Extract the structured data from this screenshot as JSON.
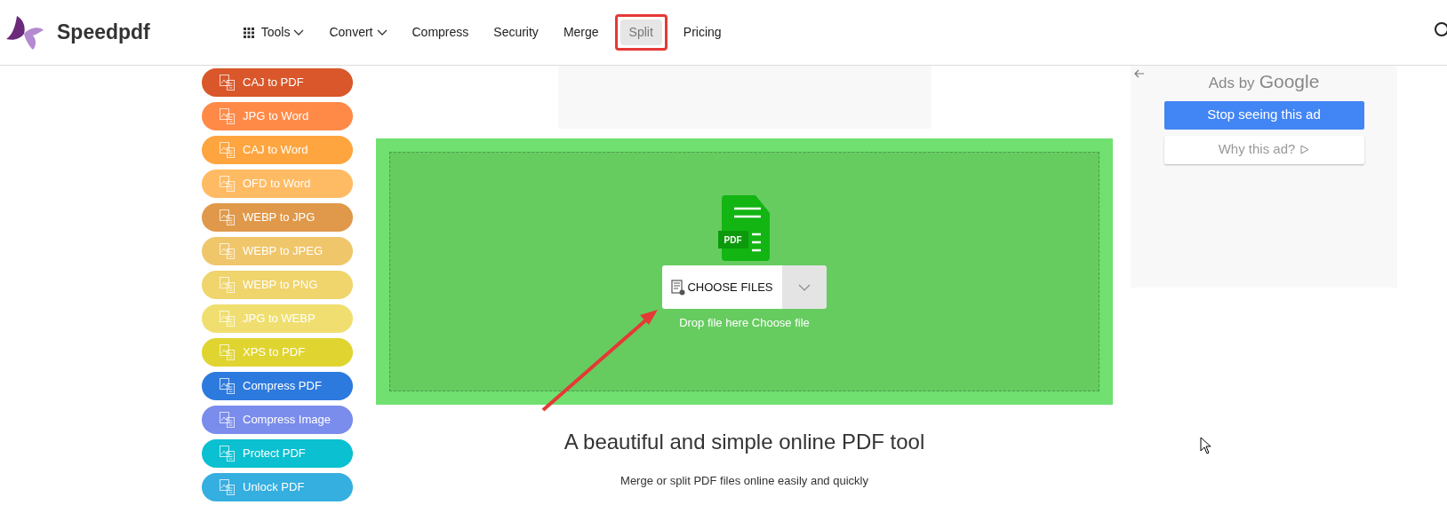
{
  "header": {
    "brand": "Speedpdf",
    "nav": [
      {
        "label": "Tools",
        "kind": "grid-menu",
        "selected": false
      },
      {
        "label": "Convert",
        "kind": "menu",
        "selected": false
      },
      {
        "label": "Compress",
        "kind": "link",
        "selected": false
      },
      {
        "label": "Security",
        "kind": "link",
        "selected": false
      },
      {
        "label": "Merge",
        "kind": "link",
        "selected": false
      },
      {
        "label": "Split",
        "kind": "link",
        "selected": true
      },
      {
        "label": "Pricing",
        "kind": "link",
        "selected": false
      }
    ]
  },
  "sidebar": {
    "items": [
      {
        "label": "CAJ to PDF",
        "color": "#d9572a"
      },
      {
        "label": "JPG to Word",
        "color": "#ff8a47"
      },
      {
        "label": "CAJ to Word",
        "color": "#ffa53f"
      },
      {
        "label": "OFD to Word",
        "color": "#ffbb63"
      },
      {
        "label": "WEBP to JPG",
        "color": "#e0994a"
      },
      {
        "label": "WEBP to JPEG",
        "color": "#f0c66b"
      },
      {
        "label": "WEBP to PNG",
        "color": "#f0d46c"
      },
      {
        "label": "JPG to WEBP",
        "color": "#f0df70"
      },
      {
        "label": "XPS to PDF",
        "color": "#e0d430"
      },
      {
        "label": "Compress PDF",
        "color": "#2d7ade"
      },
      {
        "label": "Compress Image",
        "color": "#7a8cec"
      },
      {
        "label": "Protect PDF",
        "color": "#0bc0d0"
      },
      {
        "label": "Unlock PDF",
        "color": "#35aee0"
      }
    ]
  },
  "upload": {
    "icon_label": "PDF",
    "button": "CHOOSE FILES",
    "hint": "Drop file here Choose file"
  },
  "heading": "A beautiful and simple online PDF tool",
  "subtitle": "Merge or split PDF files online easily and quickly",
  "ad": {
    "label": "Ads by",
    "brand": "Google",
    "buttons": [
      "Stop seeing this ad",
      "Why this ad?"
    ]
  }
}
